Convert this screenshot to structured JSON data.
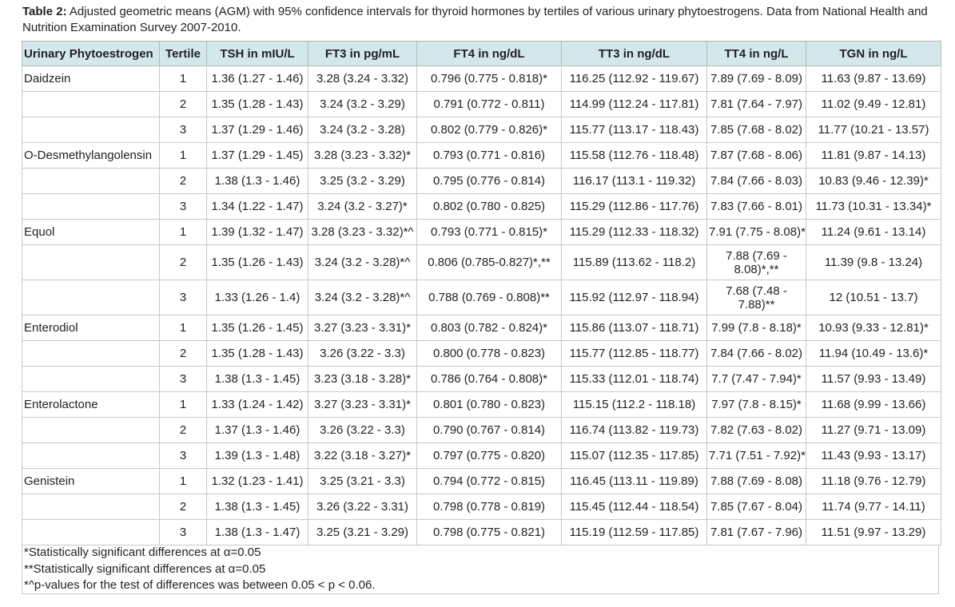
{
  "caption": {
    "label": "Table 2:",
    "text": " Adjusted geometric means (AGM) with 95% confidence intervals for thyroid hormones by tertiles of various urinary phytoestrogens. Data from National Health and Nutrition Examination Survey 2007-2010."
  },
  "headers": [
    "Urinary Phytoestrogen",
    "Tertile",
    "TSH in mIU/L",
    "FT3 in pg/mL",
    "FT4 in ng/dL",
    "TT3 in ng/dL",
    "TT4 in ng/L",
    "TGN in ng/L"
  ],
  "rows": [
    [
      "Daidzein",
      "1",
      "1.36 (1.27 - 1.46)",
      "3.28 (3.24 - 3.32)",
      "0.796 (0.775 - 0.818)*",
      "116.25 (112.92 - 119.67)",
      "7.89 (7.69 - 8.09)",
      "11.63 (9.87 - 13.69)"
    ],
    [
      "",
      "2",
      "1.35 (1.28 - 1.43)",
      "3.24 (3.2 - 3.29)",
      "0.791 (0.772 - 0.811)",
      "114.99 (112.24 - 117.81)",
      "7.81 (7.64 - 7.97)",
      "11.02 (9.49 - 12.81)"
    ],
    [
      "",
      "3",
      "1.37 (1.29 - 1.46)",
      "3.24 (3.2 - 3.28)",
      "0.802 (0.779 - 0.826)*",
      "115.77 (113.17 - 118.43)",
      "7.85 (7.68 - 8.02)",
      "11.77 (10.21 - 13.57)"
    ],
    [
      "O-Desmethylangolensin",
      "1",
      "1.37 (1.29 - 1.45)",
      "3.28 (3.23 - 3.32)*",
      "0.793 (0.771 - 0.816)",
      "115.58 (112.76 - 118.48)",
      "7.87 (7.68 - 8.06)",
      "11.81 (9.87 - 14.13)"
    ],
    [
      "",
      "2",
      "1.38 (1.3 - 1.46)",
      "3.25 (3.2 - 3.29)",
      "0.795 (0.776 - 0.814)",
      "116.17 (113.1 - 119.32)",
      "7.84 (7.66 - 8.03)",
      "10.83 (9.46 - 12.39)*"
    ],
    [
      "",
      "3",
      "1.34 (1.22 - 1.47)",
      "3.24 (3.2 - 3.27)*",
      "0.802 (0.780 - 0.825)",
      "115.29 (112.86 - 117.76)",
      "7.83 (7.66 - 8.01)",
      "11.73 (10.31 - 13.34)*"
    ],
    [
      "Equol",
      "1",
      "1.39 (1.32 - 1.47)",
      "3.28 (3.23 - 3.32)*^",
      "0.793 (0.771 - 0.815)*",
      "115.29 (112.33 - 118.32)",
      "7.91 (7.75 - 8.08)*",
      "11.24 (9.61 - 13.14)"
    ],
    [
      "",
      "2",
      "1.35 (1.26 - 1.43)",
      "3.24 (3.2 - 3.28)*^",
      "0.806 (0.785-0.827)*,**",
      "115.89 (113.62 - 118.2)",
      "7.88 (7.69 - 8.08)*,**",
      "11.39 (9.8 - 13.24)"
    ],
    [
      "",
      "3",
      "1.33 (1.26 - 1.4)",
      "3.24 (3.2 - 3.28)*^",
      "0.788 (0.769 - 0.808)**",
      "115.92 (112.97 - 118.94)",
      "7.68 (7.48 - 7.88)**",
      "12 (10.51 - 13.7)"
    ],
    [
      "Enterodiol",
      "1",
      "1.35 (1.26 - 1.45)",
      "3.27 (3.23 - 3.31)*",
      "0.803 (0.782 - 0.824)*",
      "115.86 (113.07 - 118.71)",
      "7.99 (7.8 - 8.18)*",
      "10.93 (9.33 - 12.81)*"
    ],
    [
      "",
      "2",
      "1.35 (1.28 - 1.43)",
      "3.26 (3.22 - 3.3)",
      "0.800 (0.778 - 0.823)",
      "115.77 (112.85 - 118.77)",
      "7.84 (7.66 - 8.02)",
      "11.94 (10.49 - 13.6)*"
    ],
    [
      "",
      "3",
      "1.38 (1.3 - 1.45)",
      "3.23 (3.18 - 3.28)*",
      "0.786 (0.764 - 0.808)*",
      "115.33 (112.01 - 118.74)",
      "7.7 (7.47 - 7.94)*",
      "11.57 (9.93 - 13.49)"
    ],
    [
      "Enterolactone",
      "1",
      "1.33 (1.24 - 1.42)",
      "3.27 (3.23 - 3.31)*",
      "0.801 (0.780 - 0.823)",
      "115.15 (112.2 - 118.18)",
      "7.97 (7.8 - 8.15)*",
      "11.68 (9.99 - 13.66)"
    ],
    [
      "",
      "2",
      "1.37 (1.3 - 1.46)",
      "3.26 (3.22 - 3.3)",
      "0.790 (0.767 - 0.814)",
      "116.74 (113.82 - 119.73)",
      "7.82 (7.63 - 8.02)",
      "11.27 (9.71 - 13.09)"
    ],
    [
      "",
      "3",
      "1.39 (1.3 - 1.48)",
      "3.22 (3.18 - 3.27)*",
      "0.797 (0.775 - 0.820)",
      "115.07 (112.35 - 117.85)",
      "7.71 (7.51 - 7.92)*",
      "11.43 (9.93 - 13.17)"
    ],
    [
      "Genistein",
      "1",
      "1.32 (1.23 - 1.41)",
      "3.25 (3.21 - 3.3)",
      "0.794 (0.772 - 0.815)",
      "116.45 (113.11 - 119.89)",
      "7.88 (7.69 - 8.08)",
      "11.18 (9.76 - 12.79)"
    ],
    [
      "",
      "2",
      "1.38 (1.3 - 1.45)",
      "3.26 (3.22 - 3.31)",
      "0.798 (0.778 - 0.819)",
      "115.45 (112.44 - 118.54)",
      "7.85 (7.67 - 8.04)",
      "11.74 (9.77 - 14.11)"
    ],
    [
      "",
      "3",
      "1.38 (1.3 - 1.47)",
      "3.25 (3.21 - 3.29)",
      "0.798 (0.775 - 0.821)",
      "115.19 (112.59 - 117.85)",
      "7.81 (7.67 - 7.96)",
      "11.51 (9.97 - 13.29)"
    ]
  ],
  "footnotes": [
    "*Statistically significant differences at α=0.05",
    "**Statistically significant differences at α=0.05",
    "*^p-values for the test of differences was between 0.05 < p < 0.06."
  ]
}
